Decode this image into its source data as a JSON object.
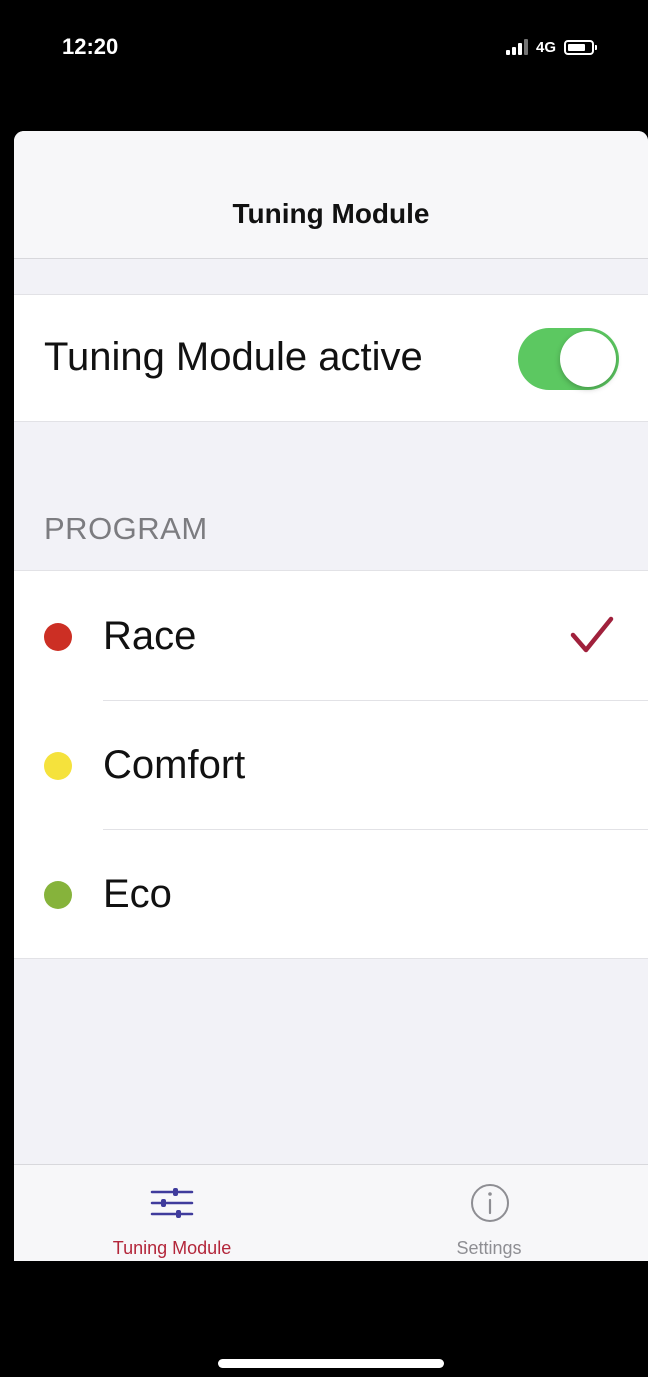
{
  "status_bar": {
    "time": "12:20",
    "network": "4G",
    "battery_level": 0.75
  },
  "nav": {
    "title": "Tuning Module"
  },
  "toggle": {
    "label": "Tuning Module active",
    "on": true,
    "color": "#5cc861"
  },
  "program": {
    "header": "PROGRAM",
    "items": [
      {
        "label": "Race",
        "dot_color": "#cc2f24",
        "selected": true
      },
      {
        "label": "Comfort",
        "dot_color": "#f5e23c",
        "selected": false
      },
      {
        "label": "Eco",
        "dot_color": "#86b33b",
        "selected": false
      }
    ],
    "check_icon": "checkmark-icon",
    "check_color": "#a0213c"
  },
  "tab_bar": {
    "tabs": [
      {
        "label": "Tuning Module",
        "icon": "sliders-icon",
        "active": true
      },
      {
        "label": "Settings",
        "icon": "info-circle-icon",
        "active": false
      }
    ]
  }
}
